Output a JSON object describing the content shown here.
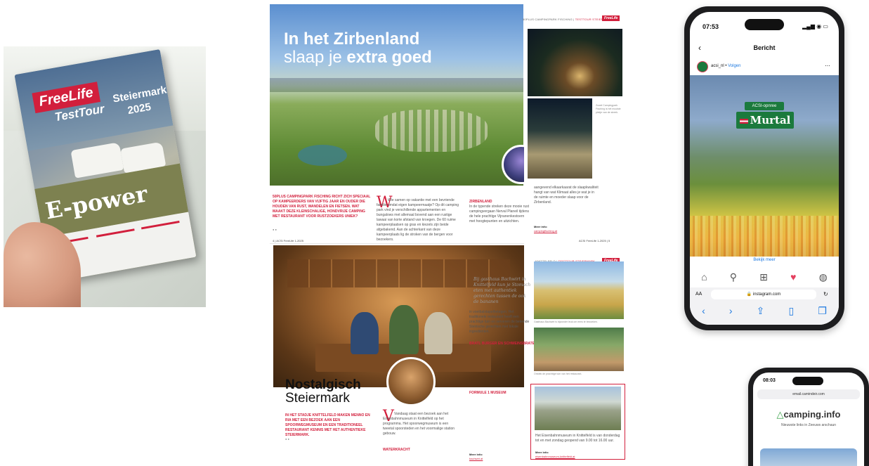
{
  "brochure": {
    "brand": "FreeLife",
    "tour": "TestTour",
    "region": "Steiermark",
    "year": "2025",
    "headline": "E-power"
  },
  "spread1": {
    "hero_word1": "In het",
    "hero_word2": "Zirbenland",
    "hero_word3": "slaap je",
    "hero_word4": "extra goed",
    "lead_red": "50PLUS CAMPINGPARK FISCHING RICHT ZICH SPECIAAL OP KAMPEERDERS VAN VIJFTIG JAAR EN OUDER DIE HOUDEN VAN RUST, WANDELEN EN FIETSEN. WAT MAAKT DEZE KLEINSCHALIGE, HONDVRIJE CAMPING MET RESTAURANT VOOR RUSTZOEKERS UNIEK?",
    "body_col1": "Wie samen op vakantie met een bevriende familie omdat eigen kampeermaatje? Op dit camping park vind je verschillende appartementen en bungalows met allemaal bovend aan een rustige lawaai van korte afstand van kroegen. De 60 ruime kampeerplaatsen op gras en kiezels zijn beide afgebakend. Aan de achterkant van deze kampeerplaats lig de stroken van de bergen voor bezoekers.",
    "page_left": "4",
    "mag_name_left": "ACSI FreeLife 1-2025",
    "section_title": "ZIRBENLAND",
    "body_col2": "In de typende streken deze mooie rust campingvergaan Nerval Planeil tijdens de hele prachtige Vijnanenkestoern met hoogtepunten en uitzichten.",
    "body_col3": "aangevend elkaarkaarat de slaapkwaliteit hangt van wat Klimaat alles je wat je in de ruimte en moeder slaap voor de Zirbenland.",
    "more_info": "Meer info:",
    "more_link": "campingfisching.at",
    "header_right": "50PLUS CAMPINGPARK FISCHING",
    "header_right_red": "TESTTOUR STEIERMARK",
    "fl_badge": "FreeLife",
    "page_right": "5",
    "mag_name_right": "ACSI FreeLife 1-2025",
    "caption": "Zowel Campingpark Fisching is het mooiste plekje van de streek."
  },
  "spread2": {
    "title_bold": "Nostalgisch",
    "title_light": "Steiermark",
    "lead_red": "IN HET STADJE KNITTELFELD MAKEN MENNO EN RIA MET EEN BEZOEK AAN EEN SPOORWEGMUSEUM EN EEN TRADITIONEEL RESTAURANT KENNIS MET HET AUTHENTIEKE STEIERMARK.",
    "body": "Vandaag staat een bezoek aan het Eisenbahnmuseum in Knittelfeld op het programma. Het spoorwegmuseum is een tweetal spoorsteden en het voormalige station gebouw.",
    "section": "WATERKRACHT",
    "quote": "Bij gasthaus Bachwirt in Knittelfeld kun je Stomach eten met authentiek gerechten tussen de ook de bananen",
    "body_mid": "in voetbalstapelhetegen. Het traditionele restaurant heeft een prachtige tuin en serveren de bekende Steirische gerechten met lokale ingrediënten.",
    "section2": "BRATL BURGER EN SCHWEINSBRATEN",
    "section3": "FORMULE 1 MUSEUM",
    "header_label": "KNITTELFELD",
    "header_red": "TESTTOUR STEIERMARK",
    "fl_badge": "FreeLife",
    "caption1": "Gasthaus Bachwirt is bijzonder leuk om eens te bezoeken.",
    "caption2": "Ontdek de prachtige tuin van het restaurant.",
    "box_text": "Het Eisenbahnmuseum in Knittelfeld is van donderdag tot en met zondag geopend van 9.00 tot 16.00 uur.",
    "box_more": "Meer info:",
    "box_link": "eisenbahnmuseum-knittelfeld.at",
    "page_more": "Meer info:",
    "page_link": "bachwirt.at"
  },
  "phone1": {
    "time": "07:53",
    "title": "Bericht",
    "account": "acsi_nl",
    "follow": "Volgen",
    "sign_top": "ACSI-opnree",
    "sign_main": "Murtal",
    "view_more": "Bekijk meer",
    "url": "instagram.com",
    "font_btn": "AA"
  },
  "phone2": {
    "time": "08:03",
    "url": "email.camindeir.com",
    "logo": "camping.info",
    "subtitle": "Nieuwste links in Zeeuws arschaun"
  }
}
